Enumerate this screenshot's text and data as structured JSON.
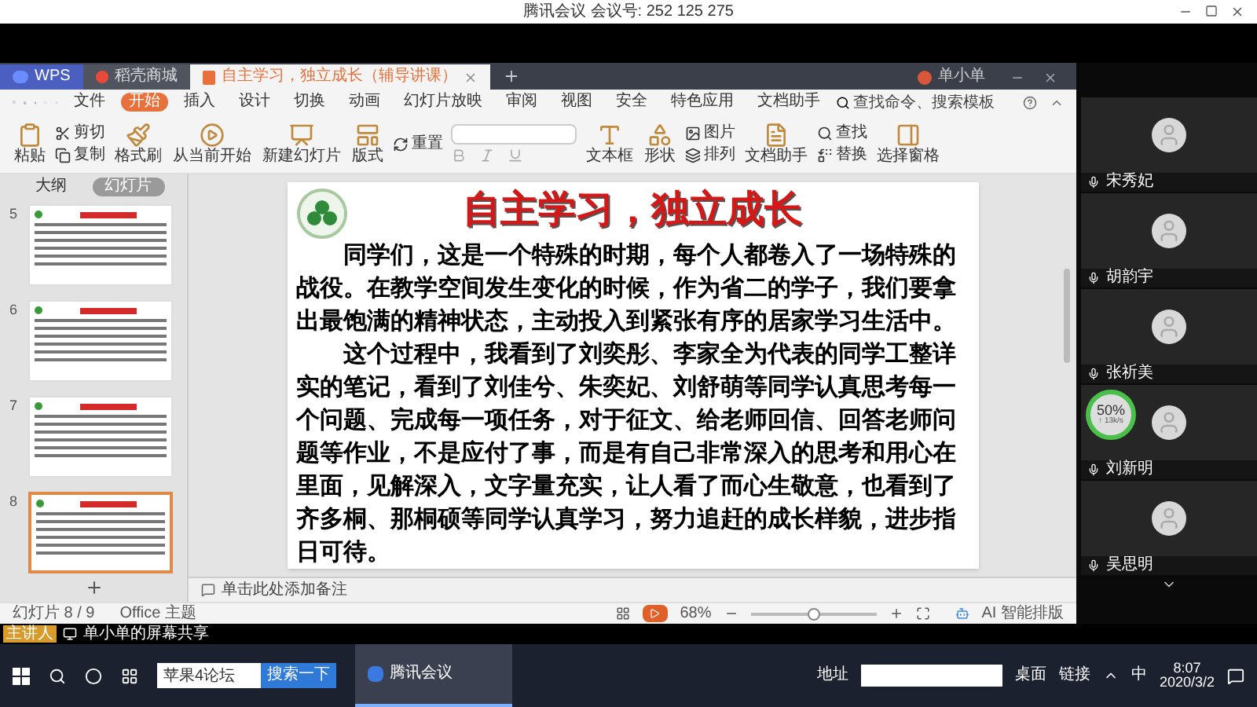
{
  "meeting_bar": {
    "title": "腾讯会议 会议号: 252 125 275"
  },
  "wps": {
    "tabs": [
      {
        "label": "WPS",
        "kind": "home",
        "selected": false
      },
      {
        "label": "稻壳商城",
        "kind": "store",
        "selected": false
      },
      {
        "label": "自主学习，独立成长（辅导讲课）",
        "kind": "doc",
        "selected": true
      }
    ],
    "user": "单小单",
    "menu": [
      {
        "label": "文件",
        "selected": false
      },
      {
        "label": "开始",
        "selected": true
      },
      {
        "label": "插入",
        "selected": false
      },
      {
        "label": "设计",
        "selected": false
      },
      {
        "label": "切换",
        "selected": false
      },
      {
        "label": "动画",
        "selected": false
      },
      {
        "label": "幻灯片放映",
        "selected": false
      },
      {
        "label": "审阅",
        "selected": false
      },
      {
        "label": "视图",
        "selected": false
      },
      {
        "label": "安全",
        "selected": false
      },
      {
        "label": "特色应用",
        "selected": false
      },
      {
        "label": "文档助手",
        "selected": false
      }
    ],
    "search": {
      "placeholder": "查找命令、搜索模板"
    },
    "ribbon": [
      {
        "kind": "big",
        "label": "粘贴"
      },
      {
        "kind": "small",
        "items": [
          {
            "label": "剪切"
          },
          {
            "label": "复制"
          }
        ]
      },
      {
        "kind": "big",
        "label": "格式刷"
      },
      {
        "kind": "big",
        "label": "从当前开始"
      },
      {
        "kind": "big",
        "label": "新建幻灯片"
      },
      {
        "kind": "big",
        "label": "版式"
      },
      {
        "kind": "small",
        "items": [
          {
            "label": "重置"
          }
        ]
      },
      {
        "kind": "font"
      },
      {
        "kind": "big",
        "label": "文本框"
      },
      {
        "kind": "big",
        "label": "形状"
      },
      {
        "kind": "small",
        "items": [
          {
            "label": "图片"
          },
          {
            "label": "排列"
          }
        ]
      },
      {
        "kind": "big",
        "label": "文档助手"
      },
      {
        "kind": "small",
        "items": [
          {
            "label": "查找"
          },
          {
            "label": "替换"
          }
        ]
      },
      {
        "kind": "big",
        "label": "选择窗格"
      }
    ],
    "panel_tabs": [
      {
        "label": "大纲",
        "selected": false
      },
      {
        "label": "幻灯片",
        "selected": true
      }
    ],
    "thumbnails": [
      {
        "number": "5",
        "selected": false
      },
      {
        "number": "6",
        "selected": false
      },
      {
        "number": "7",
        "selected": false
      },
      {
        "number": "8",
        "selected": true
      }
    ],
    "slide": {
      "title": "自主学习，独立成长",
      "paragraphs": [
        "同学们，这是一个特殊的时期，每个人都卷入了一场特殊的战役。在教学空间发生变化的时候，作为省二的学子，我们要拿出最饱满的精神状态，主动投入到紧张有序的居家学习生活中。",
        "这个过程中，我看到了刘奕彤、李家全为代表的同学工整详实的笔记，看到了刘佳兮、朱奕妃、刘舒萌等同学认真思考每一个问题、完成每一项任务，对于征文、给老师回信、回答老师问题等作业，不是应付了事，而是有自己非常深入的思考和用心在里面，见解深入，文字量充实，让人看了而心生敬意，也看到了齐多桐、那桐硕等同学认真学习，努力追赶的成长样貌，进步指日可待。"
      ]
    },
    "notes": {
      "placeholder": "单击此处添加备注"
    },
    "status_bar": {
      "slide_count": "幻灯片 8 / 9",
      "theme": "Office 主题",
      "zoom": "68%",
      "zoom_slider": {
        "level": 0.5
      },
      "ai": "AI 智能排版"
    }
  },
  "participants": [
    {
      "name": "宋秀妃"
    },
    {
      "name": "胡韵宇"
    },
    {
      "name": "张祈美"
    },
    {
      "name": "刘新明"
    },
    {
      "name": "吴思明"
    }
  ],
  "network_badge": {
    "percent": "50%",
    "speed": "↑ 13k/s"
  },
  "share_strip": {
    "tag": "主讲人",
    "label": "单小单的屏幕共享"
  },
  "taskbar": {
    "search_field": {
      "value": "苹果4论坛"
    },
    "search_button": "搜索一下",
    "apps": [
      {
        "label": "腾讯会议"
      }
    ],
    "address_label": "地址",
    "toolbars": [
      "桌面",
      "链接"
    ],
    "ime": "中",
    "time": "8:07",
    "date": "2020/3/2"
  }
}
